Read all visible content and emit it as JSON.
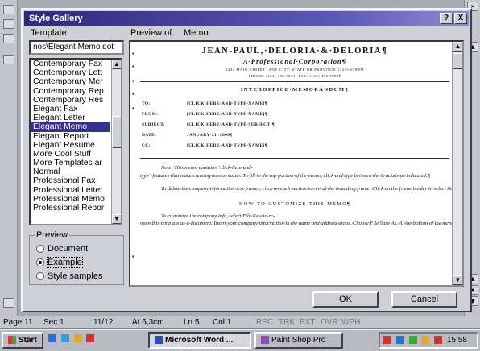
{
  "dialog": {
    "title": "Style Gallery",
    "help_label": "?",
    "close_label": "X",
    "template_label": "Template:",
    "template_value": "nos\\Elegant Memo.dot",
    "preview_of_label": "Preview of:",
    "preview_of_value": "Memo",
    "templates": [
      "Contemporary Fax",
      "Contemporary Lett",
      "Contemporary Mer",
      "Contemporary Rep",
      "Contemporary Res",
      "Elegant Fax",
      "Elegant Letter",
      "Elegant Memo",
      "Elegant Report",
      "Elegant Resume",
      "More Cool Stuff",
      "More Templates ar",
      "Normal",
      "Professional Fax",
      "Professional Letter",
      "Professional Memo",
      "Professional Repor"
    ],
    "selected_template": "Elegant Memo",
    "preview_group_label": "Preview",
    "radio_document": "Document",
    "radio_example": "Example",
    "radio_style_samples": "Style samples",
    "ok_label": "OK",
    "cancel_label": "Cancel"
  },
  "preview_doc": {
    "firm": "JEAN-PAUL,·DELORIA·&·DELORIA¶",
    "tagline": "A·Professional·Corporation¶",
    "address": "1234·MAIN·STREET··ANY·CITY,·STATE·OR·PROVINCE·12345-67890¶",
    "phone": "PHONE:·(123)·456-7890··FAX:·(123)·456-7890¶",
    "memo_title": "INTEROFFICE·MEMORANDUM¶",
    "fields": [
      {
        "name": "TO:",
        "value": "[CLICK·HERE·AND·TYPE·NAME]¶"
      },
      {
        "name": "FROM:",
        "value": "[CLICK·HERE·AND·TYPE·NAME]¶"
      },
      {
        "name": "SUBJECT:",
        "value": "[CLICK·HERE·AND·TYPE·SUBJECT]¶"
      },
      {
        "name": "DATE:",
        "value": "JANUARY·21,·2000¶"
      },
      {
        "name": "CC:",
        "value": "[CLICK·HERE·AND·TYPE·NAME]¶"
      }
    ],
    "note_paragraph": "Note:·This·memo·contains·\"click-here-and-type\"·features·that·make·creating·memos·easier.·To·fill·in·the·top·portion·of·the·memo,·click·and·type·between·the·brackets·as·indicated.¶",
    "delete_paragraph": "To·delete·the·company·information·text·frames,·click·on·each·section·to·reveal·the·bounding·frame.·Click·on·the·frame·border·to·select·the·frame,·and·press·Delete.¶",
    "heading2": "HOW·TO·CUSTOMIZE·THIS·MEMO¶",
    "customize_paragraph": "To·customize·the·company·info,·select·File·New·to·re-open·this·template·as·a·document.·Insert·your·company·information·in·the·name·and·address·areas.·Choose·File·Save·As.·At·the·bottom·of·the·menu,·choose·Document·Template·in·the·Save·File·as·Type:·box,·the·filename·..."
  },
  "statusbar": {
    "page": "Page 11",
    "sec": "Sec 1",
    "pages": "11/12",
    "at": "At 6,3cm",
    "ln": "Ln 5",
    "col": "Col 1",
    "rec": "REC",
    "trk": "TRK",
    "ext": "EXT",
    "ovr": "OVR",
    "wph": "WPH"
  },
  "taskbar": {
    "start_label": "Start",
    "word_task": "Microsoft Word ...",
    "psp_task": "Paint Shop Pro",
    "clock": "15:58"
  }
}
